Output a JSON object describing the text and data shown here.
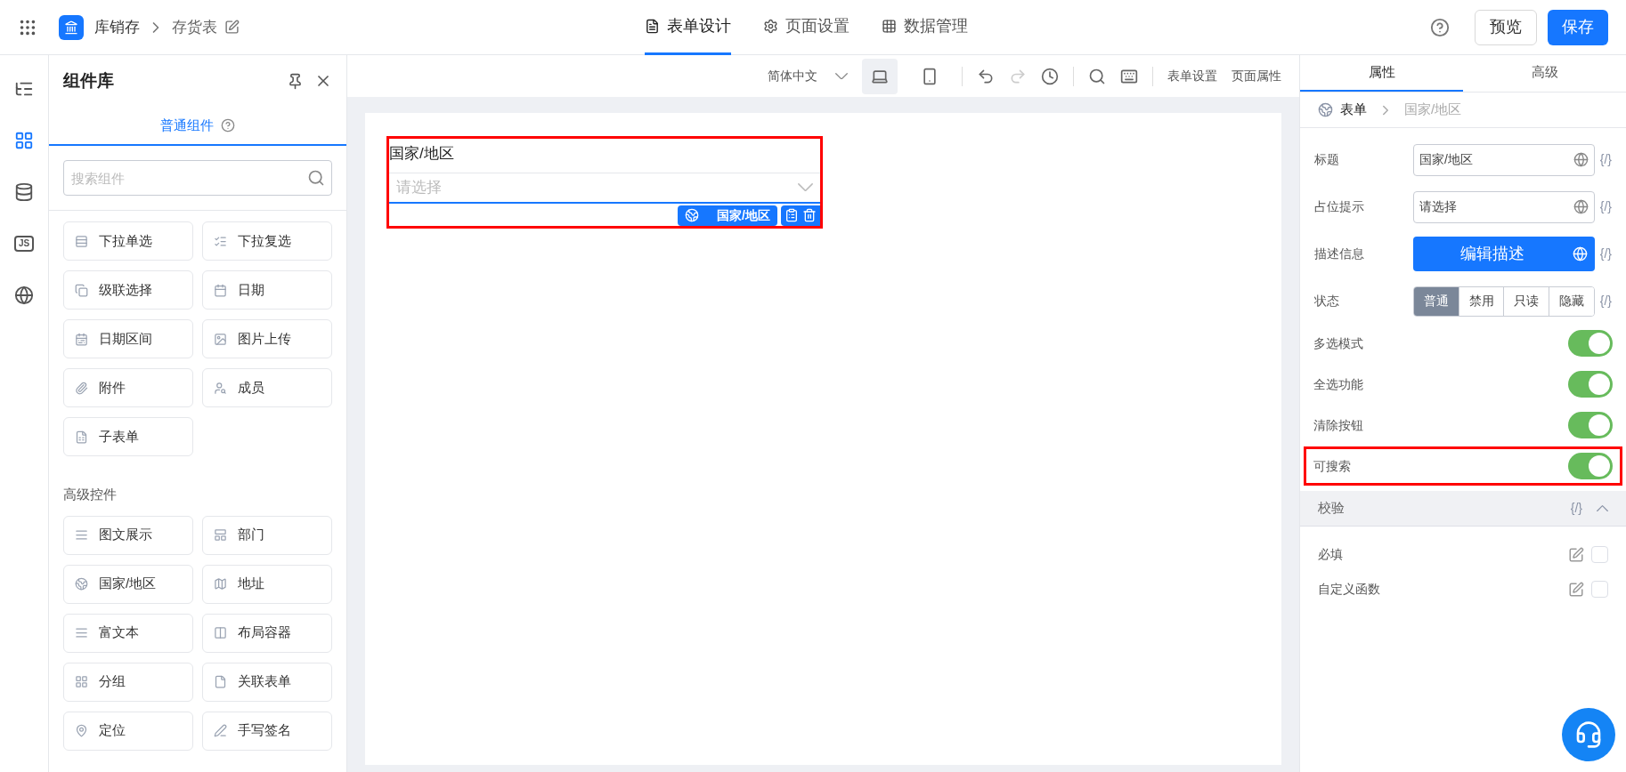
{
  "header": {
    "app_name": "库销存",
    "page_name": "存货表",
    "tabs": [
      {
        "label": "表单设计",
        "selected": true
      },
      {
        "label": "页面设置",
        "selected": false
      },
      {
        "label": "数据管理",
        "selected": false
      }
    ],
    "buttons": {
      "preview": "预览",
      "save": "保存"
    }
  },
  "rail": [
    {
      "kind": "outline",
      "selected": false
    },
    {
      "kind": "components",
      "selected": true
    },
    {
      "kind": "data",
      "selected": false
    },
    {
      "kind": "js",
      "label": "JS",
      "selected": false
    },
    {
      "kind": "globe",
      "selected": false
    }
  ],
  "library": {
    "title": "组件库",
    "tab": {
      "label": "普通组件",
      "selected": true
    },
    "search_placeholder": "搜索组件",
    "basic": [
      "下拉单选",
      "下拉复选",
      "级联选择",
      "日期",
      "日期区间",
      "图片上传",
      "附件",
      "成员",
      "子表单"
    ],
    "advanced_title": "高级控件",
    "advanced": [
      "图文展示",
      "部门",
      "国家/地区",
      "地址",
      "富文本",
      "布局容器",
      "分组",
      "关联表单",
      "定位",
      "手写签名"
    ]
  },
  "toolbar": {
    "language": "简体中文",
    "devices": [
      {
        "kind": "desktop",
        "selected": true
      },
      {
        "kind": "mobile",
        "selected": false
      }
    ],
    "form_settings": "表单设置",
    "page_props": "页面属性"
  },
  "canvas": {
    "field": {
      "label": "国家/地区",
      "placeholder": "请选择",
      "badge": "国家/地区"
    }
  },
  "props": {
    "tabs": [
      {
        "label": "属性",
        "selected": true
      },
      {
        "label": "高级",
        "selected": false
      }
    ],
    "breadcrumb": {
      "root": "表单",
      "current": "国家/地区"
    },
    "fields": [
      {
        "kind": "input",
        "label": "标题",
        "value": "国家/地区",
        "code": "{/}"
      },
      {
        "kind": "input",
        "label": "占位提示",
        "value": "请选择",
        "code": "{/}"
      },
      {
        "kind": "button",
        "label": "描述信息",
        "value": "编辑描述",
        "code": "{/}"
      },
      {
        "kind": "segmented",
        "label": "状态",
        "options": [
          {
            "label": "普通",
            "selected": true
          },
          {
            "label": "禁用",
            "selected": false
          },
          {
            "label": "只读",
            "selected": false
          },
          {
            "label": "隐藏",
            "selected": false
          }
        ],
        "code": "{/}"
      }
    ],
    "toggles": [
      {
        "label": "多选模式",
        "on": true,
        "highlighted": false
      },
      {
        "label": "全选功能",
        "on": true,
        "highlighted": false
      },
      {
        "label": "清除按钮",
        "on": true,
        "highlighted": false
      },
      {
        "label": "可搜索",
        "on": true,
        "highlighted": true
      }
    ],
    "validation": {
      "title": "校验",
      "code": "{/}",
      "expanded": true,
      "rules": [
        {
          "label": "必填",
          "checked": false
        },
        {
          "label": "自定义函数",
          "checked": false
        }
      ]
    }
  }
}
